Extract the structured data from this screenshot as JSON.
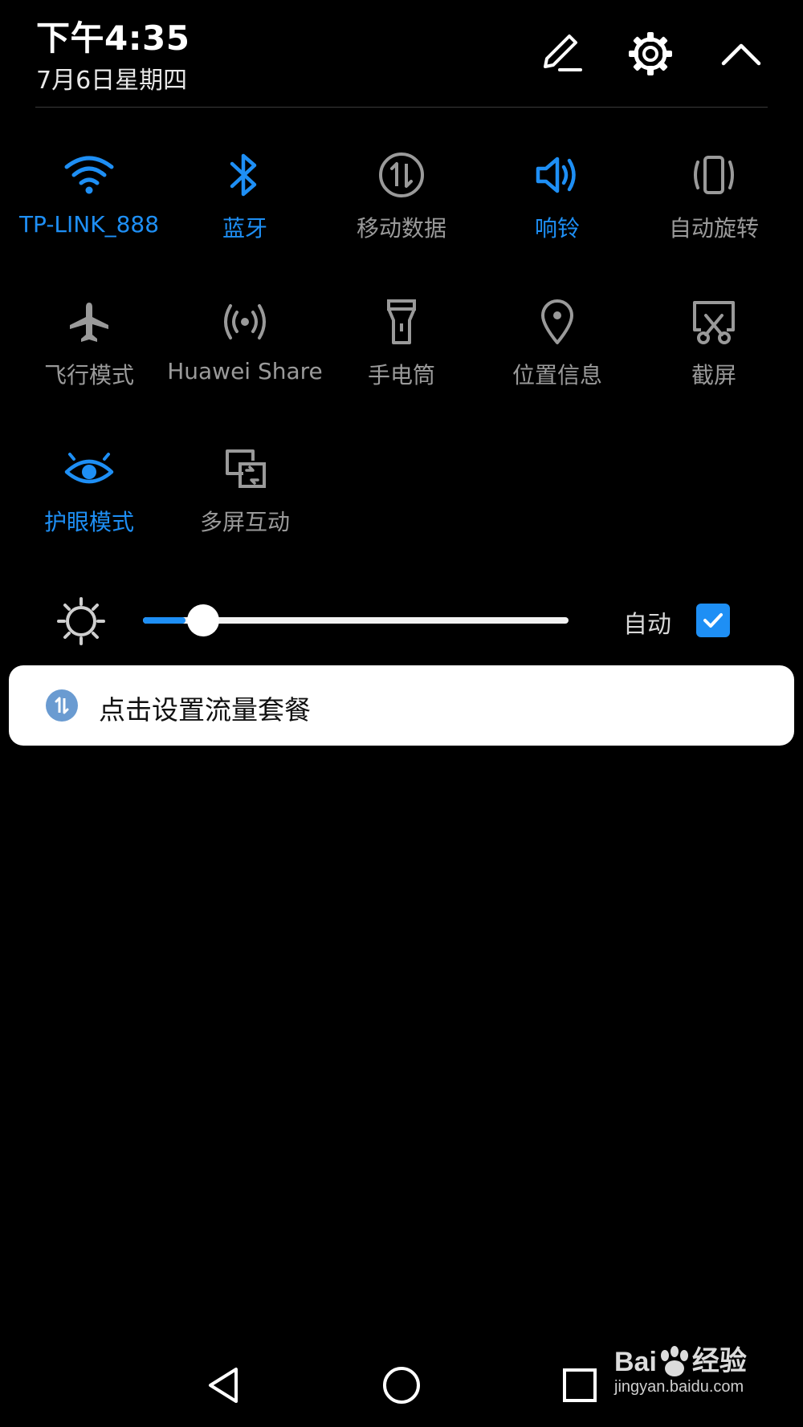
{
  "status": {
    "time": "下午4:35",
    "date": "7月6日星期四"
  },
  "header_icons": [
    "edit-icon",
    "settings-icon",
    "collapse-icon"
  ],
  "tiles": [
    {
      "label": "TP-LINK_888",
      "icon": "wifi-icon",
      "active": true
    },
    {
      "label": "蓝牙",
      "icon": "bluetooth-icon",
      "active": true
    },
    {
      "label": "移动数据",
      "icon": "mobile-data-icon",
      "active": false
    },
    {
      "label": "响铃",
      "icon": "speaker-icon",
      "active": true
    },
    {
      "label": "自动旋转",
      "icon": "auto-rotate-icon",
      "active": false
    },
    {
      "label": "飞行模式",
      "icon": "airplane-icon",
      "active": false
    },
    {
      "label": "Huawei Share",
      "icon": "huawei-share-icon",
      "active": false
    },
    {
      "label": "手电筒",
      "icon": "flashlight-icon",
      "active": false
    },
    {
      "label": "位置信息",
      "icon": "location-icon",
      "active": false
    },
    {
      "label": "截屏",
      "icon": "screenshot-icon",
      "active": false
    },
    {
      "label": "护眼模式",
      "icon": "eye-comfort-icon",
      "active": true
    },
    {
      "label": "多屏互动",
      "icon": "multi-screen-icon",
      "active": false
    }
  ],
  "brightness": {
    "level": 0.1,
    "auto_label": "自动",
    "auto_checked": true
  },
  "notification": {
    "text": "点击设置流量套餐",
    "icon": "data-traffic-icon"
  },
  "nav": [
    "back-icon",
    "home-icon",
    "recents-icon"
  ],
  "watermark": {
    "brand": "Bai",
    "brand_suffix": "经验",
    "url": "jingyan.baidu.com"
  },
  "colors": {
    "accent": "#1e8ff5",
    "inactive": "#9a9a9a",
    "background": "#000000"
  }
}
